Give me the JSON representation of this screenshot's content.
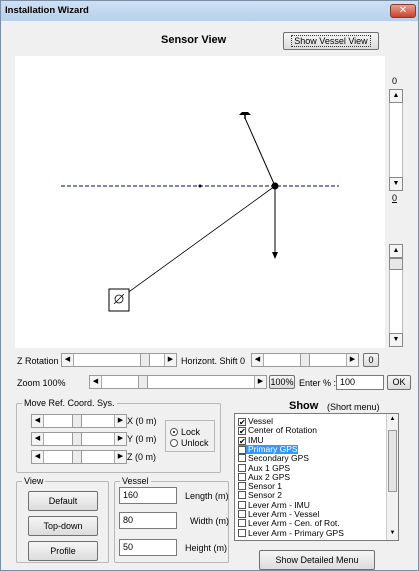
{
  "window": {
    "title": "Installation Wizard",
    "close_glyph": "✕"
  },
  "header": {
    "title": "Sensor View",
    "vessel_view_button": "Show Vessel View"
  },
  "right_scroll": {
    "top_value": "0",
    "mid_value": "0"
  },
  "z_rotation": {
    "label": "Z Rotation"
  },
  "horiz_shift": {
    "label": "Horizont. Shift",
    "value": "0",
    "end_value": "0"
  },
  "zoom": {
    "label": "Zoom 100%",
    "button": "100%",
    "enter_label": "Enter % :",
    "enter_value": "100",
    "ok": "OK"
  },
  "move_ref": {
    "title": "Move Ref. Coord. Sys.",
    "x_label": "X (0 m)",
    "y_label": "Y (0 m)",
    "z_label": "Z (0 m)",
    "lock": "Lock",
    "unlock": "Unlock"
  },
  "view": {
    "title": "View",
    "default": "Default",
    "top_down": "Top-down",
    "profile": "Profile"
  },
  "vessel": {
    "title": "Vessel",
    "length_value": "160",
    "length_label": "Length (m)",
    "width_value": "80",
    "width_label": "Width (m)",
    "height_value": "50",
    "height_label": "Height (m)"
  },
  "show": {
    "title": "Show",
    "subtitle": "(Short menu)",
    "items": [
      {
        "label": "Vessel",
        "checked": true,
        "selected": false
      },
      {
        "label": "Center of Rotation",
        "checked": true,
        "selected": false
      },
      {
        "label": "IMU",
        "checked": true,
        "selected": false
      },
      {
        "label": "Primary GPS",
        "checked": true,
        "selected": true
      },
      {
        "label": "Secondary GPS",
        "checked": false,
        "selected": false
      },
      {
        "label": "Aux 1 GPS",
        "checked": false,
        "selected": false
      },
      {
        "label": "Aux 2 GPS",
        "checked": false,
        "selected": false
      },
      {
        "label": "Sensor 1",
        "checked": false,
        "selected": false
      },
      {
        "label": "Sensor 2",
        "checked": false,
        "selected": false
      },
      {
        "label": "Lever Arm - IMU",
        "checked": false,
        "selected": false
      },
      {
        "label": "Lever Arm - Vessel",
        "checked": false,
        "selected": false
      },
      {
        "label": "Lever Arm - Cen. of Rot.",
        "checked": false,
        "selected": false
      },
      {
        "label": "Lever Arm - Primary GPS",
        "checked": false,
        "selected": false
      }
    ],
    "detailed_button": "Show Detailed Menu"
  },
  "colors": {
    "axis_blue": "#00008b",
    "selection": "#3399ff",
    "title_bar": "#c4d8f0"
  }
}
